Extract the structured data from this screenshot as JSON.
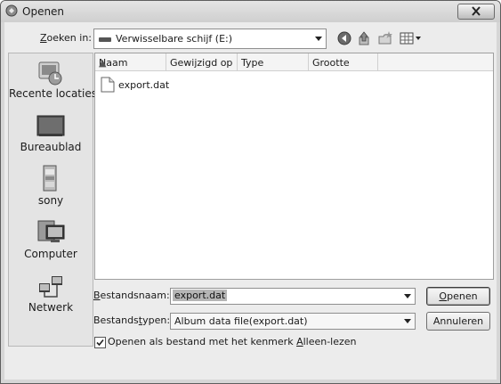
{
  "window": {
    "title": "Openen"
  },
  "lookin": {
    "label_prefix": "",
    "label_underlined": "Z",
    "label_rest": "oeken in:",
    "value": "Verwisselbare schijf (E:)"
  },
  "toolbar": {
    "icons": [
      "back-icon",
      "up-folder-icon",
      "new-folder-icon",
      "view-menu-icon"
    ]
  },
  "places": [
    {
      "label": "Recente locaties",
      "icon": "recent-locations-icon"
    },
    {
      "label": "Bureaublad",
      "icon": "desktop-icon"
    },
    {
      "label": "sony",
      "icon": "user-folder-icon"
    },
    {
      "label": "Computer",
      "icon": "computer-icon"
    },
    {
      "label": "Netwerk",
      "icon": "network-icon"
    }
  ],
  "filelist": {
    "columns": [
      "Naam",
      "Gewijzigd op",
      "Type",
      "Grootte"
    ],
    "files": [
      {
        "name": "export.dat",
        "icon": "file-icon"
      }
    ]
  },
  "filename": {
    "label_underlined": "B",
    "label_rest": "estandsnaam:",
    "value": "export.dat"
  },
  "filetype": {
    "label_prefix": "Bestands",
    "label_underlined": "t",
    "label_rest": "ypen:",
    "value": "Album data file(export.dat)"
  },
  "buttons": {
    "open_underlined": "O",
    "open_rest": "penen",
    "cancel": "Annuleren"
  },
  "readonly": {
    "label_prefix": "Openen als bestand met het kenmerk ",
    "label_underlined": "A",
    "label_rest": "lleen-lezen",
    "checked": true
  }
}
